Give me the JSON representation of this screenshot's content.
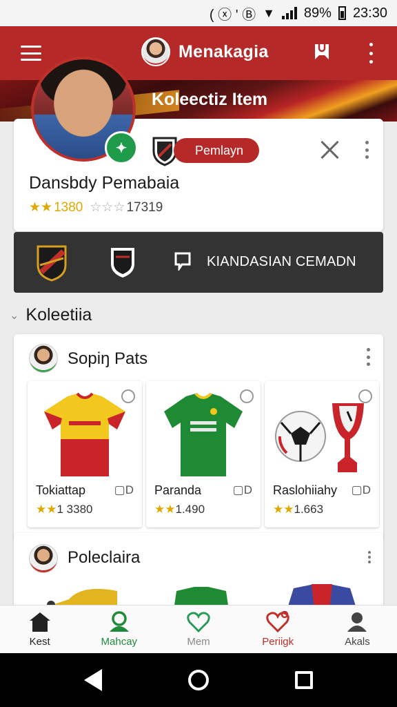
{
  "status_bar": {
    "icons_text": "( ⓧ ' Ⓑ",
    "battery": "89%",
    "time": "23:30"
  },
  "app_bar": {
    "title": "Menakagia"
  },
  "banner": {
    "title": "Koleectiz Item"
  },
  "profile": {
    "pill_label": "Pemlayn",
    "name": "Dansbdy Pemabaia",
    "rating_value": "1380",
    "rating_count": "17319"
  },
  "strip": {
    "label": "KIANDASIAN CEMADN"
  },
  "section": {
    "title": "Koleetiia"
  },
  "collections": [
    {
      "title": "Sopiŋ Pats",
      "items": [
        {
          "name": "Tokiattap",
          "chat": "D",
          "rating": "1 3380",
          "image": "yellow-red-jersey"
        },
        {
          "name": "Paranda",
          "chat": "D",
          "rating": "1.490",
          "image": "green-jersey"
        },
        {
          "name": "Raslohiiahy",
          "chat": "D",
          "rating": "1.663",
          "image": "ball-and-trophy"
        }
      ]
    },
    {
      "title": "Poleclaira"
    }
  ],
  "bottom_nav": [
    {
      "label": "Kest",
      "icon": "home-icon",
      "color": "#222222"
    },
    {
      "label": "Mahcay",
      "icon": "profile-icon",
      "color": "#1f8a3a"
    },
    {
      "label": "Mem",
      "icon": "heart-icon",
      "color": "#888888"
    },
    {
      "label": "Periigk",
      "icon": "heart-ring-icon",
      "color": "#c0302a"
    },
    {
      "label": "Akals",
      "icon": "account-icon",
      "color": "#444444"
    }
  ],
  "colors": {
    "accent": "#b52a28",
    "dark_strip": "#333333",
    "green": "#1f9a48",
    "star": "#e0a800"
  }
}
